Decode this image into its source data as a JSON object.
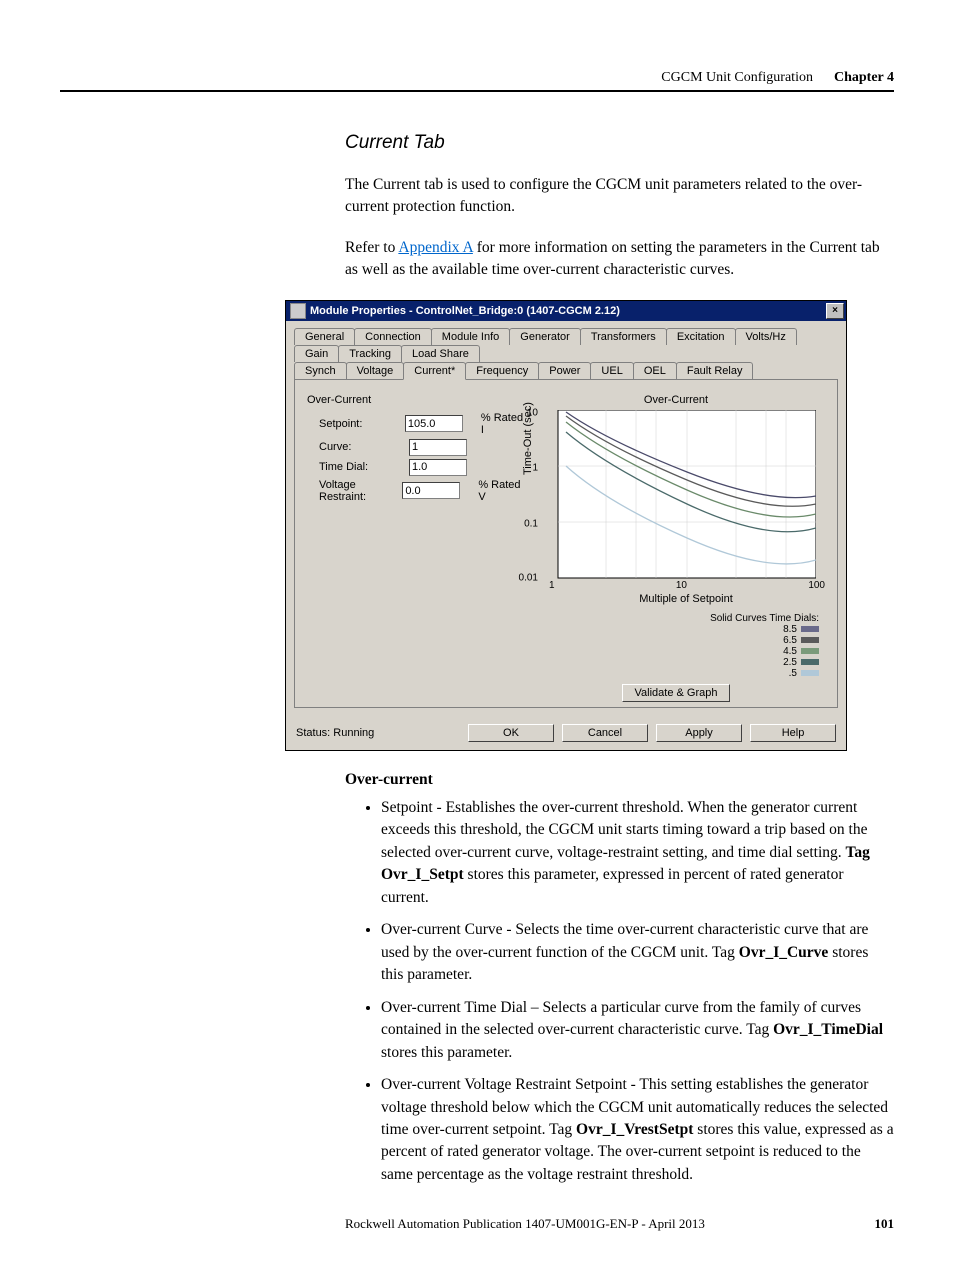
{
  "header": {
    "section": "CGCM Unit Configuration",
    "chapter": "Chapter 4"
  },
  "section_title": "Current Tab",
  "para1": "The Current tab is used to configure the CGCM unit parameters related to the over-current protection function.",
  "para2_pre": "Refer to ",
  "para2_link": "Appendix A",
  "para2_post": " for more information on setting the parameters in the Current tab as well as the available time over-current characteristic curves.",
  "dialog": {
    "title": "Module Properties - ControlNet_Bridge:0 (1407-CGCM 2.12)",
    "tabs_row1": [
      "General",
      "Connection",
      "Module Info",
      "Generator",
      "Transformers",
      "Excitation",
      "Volts/Hz",
      "Gain",
      "Tracking",
      "Load Share"
    ],
    "tabs_row2": [
      "Synch",
      "Voltage",
      "Current*",
      "Frequency",
      "Power",
      "UEL",
      "OEL",
      "Fault Relay"
    ],
    "active_tab": "Current*",
    "group": "Over-Current",
    "fields": {
      "setpoint_label": "Setpoint:",
      "setpoint_value": "105.0",
      "setpoint_unit": "% Rated I",
      "curve_label": "Curve:",
      "curve_value": "1",
      "timedial_label": "Time Dial:",
      "timedial_value": "1.0",
      "vrest_label": "Voltage Restraint:",
      "vrest_value": "0.0",
      "vrest_unit": "% Rated V"
    },
    "chart": {
      "title": "Over-Current",
      "ylabel": "Time-Out (sec)",
      "xlabel": "Multiple of Setpoint",
      "yticks": [
        "10",
        "1",
        "0.1",
        "0.01"
      ],
      "xticks": [
        "1",
        "10",
        "100"
      ],
      "legend_title": "Solid Curves Time Dials:",
      "legend": [
        {
          "label": "8.5",
          "color": "#6a6a8a"
        },
        {
          "label": "6.5",
          "color": "#5a5a5a"
        },
        {
          "label": "4.5",
          "color": "#7a9a7a"
        },
        {
          "label": "2.5",
          "color": "#4a6a6a"
        },
        {
          "label": ".5",
          "color": "#b0c8d8"
        }
      ]
    },
    "validate_btn": "Validate & Graph",
    "status": "Status: Running",
    "buttons": {
      "ok": "OK",
      "cancel": "Cancel",
      "apply": "Apply",
      "help": "Help"
    }
  },
  "chart_data": {
    "type": "line",
    "title": "Over-Current",
    "xlabel": "Multiple of Setpoint",
    "ylabel": "Time-Out (sec)",
    "x_scale": "log",
    "y_scale": "log",
    "xlim": [
      1,
      100
    ],
    "ylim": [
      0.01,
      10
    ],
    "series": [
      {
        "name": "8.5",
        "x": [
          1.2,
          2,
          5,
          10,
          30,
          100
        ],
        "y": [
          10,
          3.5,
          1.2,
          0.7,
          0.35,
          0.18
        ]
      },
      {
        "name": "6.5",
        "x": [
          1.2,
          2,
          5,
          10,
          30,
          100
        ],
        "y": [
          8,
          2.7,
          0.95,
          0.55,
          0.28,
          0.14
        ]
      },
      {
        "name": "4.5",
        "x": [
          1.2,
          2,
          5,
          10,
          30,
          100
        ],
        "y": [
          6,
          1.9,
          0.68,
          0.4,
          0.2,
          0.1
        ]
      },
      {
        "name": "2.5",
        "x": [
          1.2,
          2,
          5,
          10,
          30,
          100
        ],
        "y": [
          3.5,
          1.1,
          0.4,
          0.23,
          0.12,
          0.06
        ]
      },
      {
        "name": ".5",
        "x": [
          1.2,
          2,
          5,
          10,
          30,
          100
        ],
        "y": [
          0.8,
          0.25,
          0.09,
          0.05,
          0.026,
          0.013
        ]
      }
    ]
  },
  "body": {
    "heading": "Over-current",
    "items": [
      {
        "pre": "Setpoint - Establishes the over-current threshold. When the generator current exceeds this threshold, the CGCM unit starts timing toward a trip based on the selected over-current curve, voltage-restraint setting, and time dial setting. ",
        "bold": "Tag Ovr_I_Setpt",
        "post": " stores this parameter, expressed in percent of rated generator current."
      },
      {
        "pre": "Over-current Curve - Selects the time over-current characteristic curve that are used by the over-current function of the CGCM unit. Tag ",
        "bold": "Ovr_I_Curve",
        "post": " stores this parameter."
      },
      {
        "pre": "Over-current Time Dial – Selects a particular curve from the family of curves contained in the selected over-current characteristic curve. Tag ",
        "bold": "Ovr_I_TimeDial",
        "post": " stores this parameter."
      },
      {
        "pre": "Over-current Voltage Restraint Setpoint - This setting establishes the generator voltage threshold below which the CGCM unit automatically reduces the selected time over-current setpoint. Tag ",
        "bold": "Ovr_I_VrestSetpt",
        "post": " stores this value, expressed as a percent of rated generator voltage. The over-current setpoint is reduced to the same percentage as the voltage restraint threshold."
      }
    ]
  },
  "footer": {
    "pub": "Rockwell Automation Publication 1407-UM001G-EN-P - April 2013",
    "page": "101"
  }
}
